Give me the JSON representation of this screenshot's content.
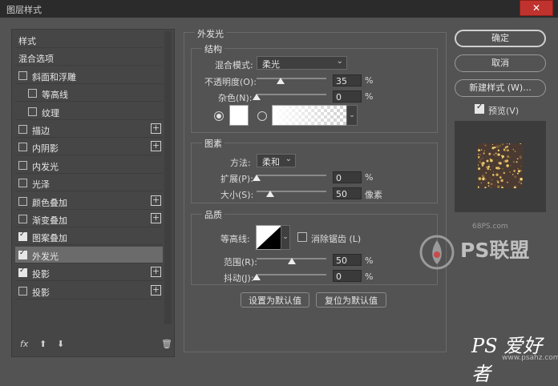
{
  "window": {
    "title": "图层样式",
    "close": "✕"
  },
  "sidebar": {
    "items": [
      {
        "label": "样式",
        "checkbox": false,
        "checked": false,
        "plus": false,
        "indent": 0
      },
      {
        "label": "混合选项",
        "checkbox": false,
        "checked": false,
        "plus": false,
        "indent": 0
      },
      {
        "label": "斜面和浮雕",
        "checkbox": true,
        "checked": false,
        "plus": false,
        "indent": 0
      },
      {
        "label": "等高线",
        "checkbox": true,
        "checked": false,
        "plus": false,
        "indent": 1
      },
      {
        "label": "纹理",
        "checkbox": true,
        "checked": false,
        "plus": false,
        "indent": 1
      },
      {
        "label": "描边",
        "checkbox": true,
        "checked": false,
        "plus": true,
        "indent": 0
      },
      {
        "label": "内阴影",
        "checkbox": true,
        "checked": false,
        "plus": true,
        "indent": 0
      },
      {
        "label": "内发光",
        "checkbox": true,
        "checked": false,
        "plus": false,
        "indent": 0
      },
      {
        "label": "光泽",
        "checkbox": true,
        "checked": false,
        "plus": false,
        "indent": 0
      },
      {
        "label": "颜色叠加",
        "checkbox": true,
        "checked": false,
        "plus": true,
        "indent": 0
      },
      {
        "label": "渐变叠加",
        "checkbox": true,
        "checked": false,
        "plus": true,
        "indent": 0
      },
      {
        "label": "图案叠加",
        "checkbox": true,
        "checked": true,
        "plus": false,
        "indent": 0
      },
      {
        "label": "外发光",
        "checkbox": true,
        "checked": true,
        "plus": false,
        "indent": 0,
        "selected": true
      },
      {
        "label": "投影",
        "checkbox": true,
        "checked": true,
        "plus": true,
        "indent": 0
      },
      {
        "label": "投影",
        "checkbox": true,
        "checked": false,
        "plus": true,
        "indent": 0
      }
    ],
    "tools": {
      "fx": "fx",
      "up": "⬆",
      "down": "⬇",
      "trash": "🗑"
    }
  },
  "panel": {
    "title": "外发光",
    "structure": {
      "heading": "结构",
      "blend_label": "混合模式:",
      "blend_value": "柔光",
      "opacity_label": "不透明度(O):",
      "opacity_value": "35",
      "opacity_fraction": 0.35,
      "noise_label": "杂色(N):",
      "noise_value": "0",
      "noise_fraction": 0.0,
      "percent": "%"
    },
    "elements": {
      "heading": "图素",
      "method_label": "方法:",
      "method_value": "柔和",
      "spread_label": "扩展(P):",
      "spread_value": "0",
      "spread_fraction": 0.0,
      "size_label": "大小(S):",
      "size_value": "50",
      "size_fraction": 0.2,
      "px": "像素",
      "percent": "%"
    },
    "quality": {
      "heading": "品质",
      "contour_label": "等高线:",
      "antialias_label": "消除锯齿 (L)",
      "range_label": "范围(R):",
      "range_value": "50",
      "range_fraction": 0.5,
      "jitter_label": "抖动(J):",
      "jitter_value": "0",
      "jitter_fraction": 0.0,
      "percent": "%"
    },
    "buttons": {
      "set_default": "设置为默认值",
      "reset_default": "复位为默认值"
    }
  },
  "right": {
    "ok": "确定",
    "cancel": "取消",
    "new_style": "新建样式 (W)...",
    "preview_label": "预览(V)",
    "preview_checked": true
  },
  "watermark": {
    "site": "68PS.com",
    "brand": "PS联盟",
    "bottom": "PS 爱好者",
    "url": "www.psahz.com"
  }
}
